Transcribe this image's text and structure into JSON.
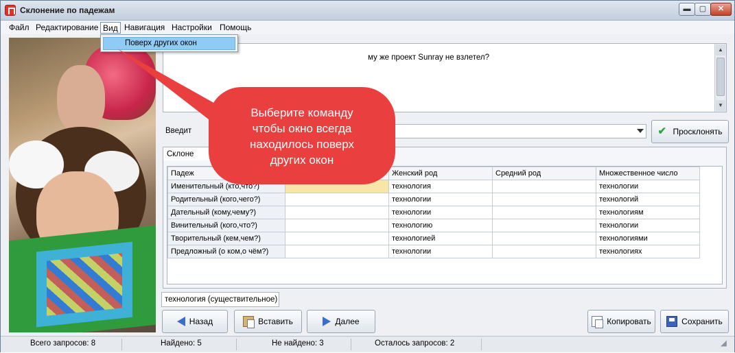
{
  "window": {
    "title": "Склонение по падежам",
    "min_symbol": "▬",
    "max_symbol": "▢",
    "close_symbol": "✕"
  },
  "menu": {
    "items": [
      "Файл",
      "Редактирование",
      "Вид",
      "Навигация",
      "Настройки",
      "Помощь"
    ],
    "active": "Вид",
    "dropdown_item": "Поверх других окон"
  },
  "source_text": {
    "visible_fragment": "му же проект Sunray не взлетел?"
  },
  "input": {
    "label_fragment": "Введит"
  },
  "buttons": {
    "decline": "Просклонять",
    "back": "Назад",
    "paste": "Вставить",
    "next": "Далее",
    "copy": "Копировать",
    "save": "Сохранить"
  },
  "top_tab": "Склоне",
  "grid": {
    "headers": [
      "Падеж",
      "",
      "Женский род",
      "Средний род",
      "Множественное число"
    ],
    "rows": [
      [
        "Именительный (кто,что?)",
        "",
        "технология",
        "",
        "технологии"
      ],
      [
        "Родительный (кого,чего?)",
        "",
        "технологии",
        "",
        "технологий"
      ],
      [
        "Дательный (кому,чему?)",
        "",
        "технологии",
        "",
        "технологиям"
      ],
      [
        "Винительный (кого,что?)",
        "",
        "технологию",
        "",
        "технологии"
      ],
      [
        "Творительный (кем,чем?)",
        "",
        "технологией",
        "",
        "технологиями"
      ],
      [
        "Предложный (о ком,о чём?)",
        "",
        "технологии",
        "",
        "технологиях"
      ]
    ]
  },
  "bottom_tab": "технология (существительное)",
  "status": {
    "total": "Всего запросов: 8",
    "found": "Найдено: 5",
    "not_found": "Не найдено: 3",
    "remaining": "Осталось запросов: 2"
  },
  "callout": {
    "lines": [
      "Выберите команду",
      "чтобы окно всегда",
      "находилось поверх",
      "других окон"
    ],
    "color": "#e9403f"
  }
}
